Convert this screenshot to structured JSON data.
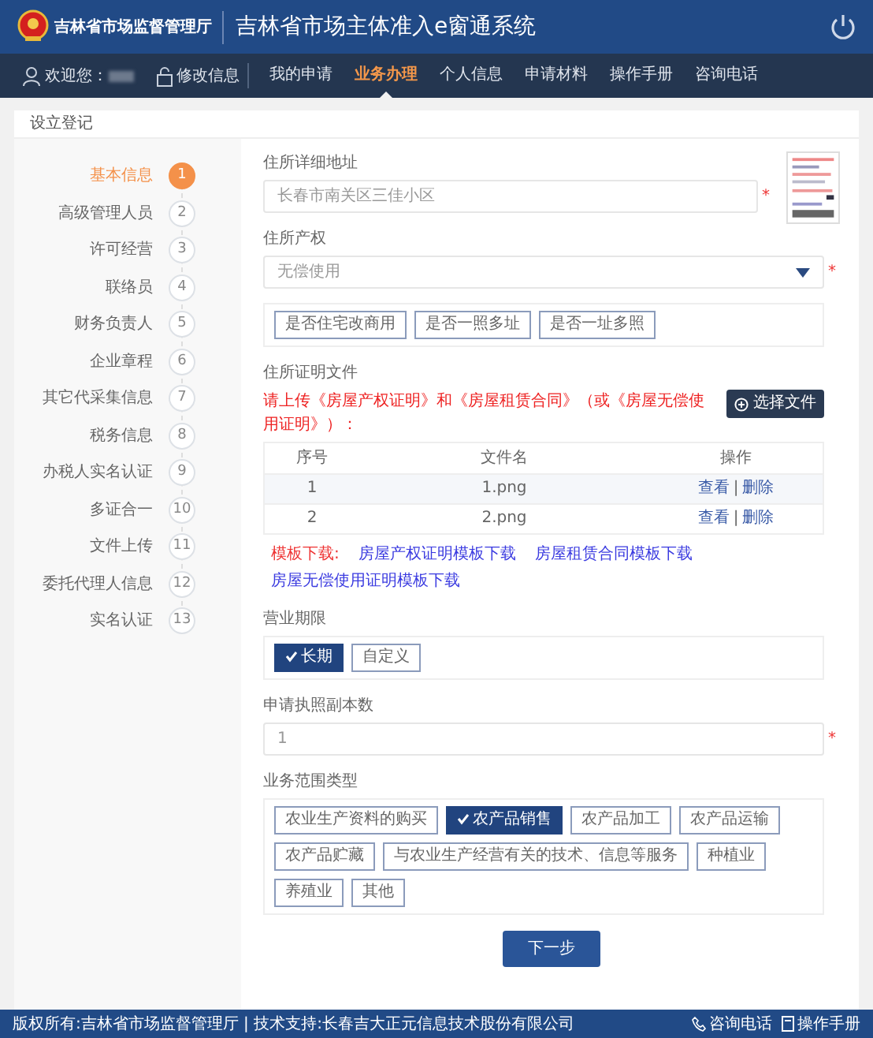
{
  "header": {
    "agency": "吉林省市场监督管理厅",
    "system_title": "吉林省市场主体准入e窗通系统"
  },
  "user_bar": {
    "welcome": "欢迎您：",
    "edit_info": "修改信息"
  },
  "nav": [
    {
      "label": "我的申请",
      "selected": false
    },
    {
      "label": "业务办理",
      "selected": true
    },
    {
      "label": "个人信息",
      "selected": false
    },
    {
      "label": "申请材料",
      "selected": false
    },
    {
      "label": "操作手册",
      "selected": false
    },
    {
      "label": "咨询电话",
      "selected": false
    }
  ],
  "card_title": "设立登记",
  "steps": [
    {
      "number": "1",
      "label": "基本信息",
      "selected": true
    },
    {
      "number": "2",
      "label": "高级管理人员",
      "selected": false
    },
    {
      "number": "3",
      "label": "许可经营",
      "selected": false
    },
    {
      "number": "4",
      "label": "联络员",
      "selected": false
    },
    {
      "number": "5",
      "label": "财务负责人",
      "selected": false
    },
    {
      "number": "6",
      "label": "企业章程",
      "selected": false
    },
    {
      "number": "7",
      "label": "其它代采集信息",
      "selected": false
    },
    {
      "number": "8",
      "label": "税务信息",
      "selected": false
    },
    {
      "number": "9",
      "label": "办税人实名认证",
      "selected": false
    },
    {
      "number": "10",
      "label": "多证合一",
      "selected": false
    },
    {
      "number": "11",
      "label": "文件上传",
      "selected": false
    },
    {
      "number": "12",
      "label": "委托代理人信息",
      "selected": false
    },
    {
      "number": "13",
      "label": "实名认证",
      "selected": false
    }
  ],
  "address": {
    "label": "住所详细地址",
    "value": "长春市南关区三佳小区",
    "required_mark": "*"
  },
  "property": {
    "label": "住所产权",
    "value": "无偿使用",
    "required_mark": "*"
  },
  "property_options": [
    {
      "label": "是否住宅改商用",
      "selected": false
    },
    {
      "label": "是否一照多址",
      "selected": false
    },
    {
      "label": "是否一址多照",
      "selected": false
    }
  ],
  "proof_files": {
    "label": "住所证明文件",
    "instruction": "请上传《房屋产权证明》和《房屋租赁合同》（或《房屋无偿使用证明》）：",
    "choose_button": "选择文件",
    "columns": [
      "序号",
      "文件名",
      "操作"
    ],
    "rows": [
      {
        "index": "1",
        "file": "1.png",
        "view": "查看",
        "separator": "|",
        "delete": "删除"
      },
      {
        "index": "2",
        "file": "2.png",
        "view": "查看",
        "separator": "|",
        "delete": "删除"
      }
    ],
    "template_label": "模板下载:",
    "template_links": [
      "房屋产权证明模板下载",
      "房屋租赁合同模板下载",
      "房屋无偿使用证明模板下载"
    ]
  },
  "term": {
    "label": "营业期限",
    "options": [
      {
        "label": "长期",
        "selected": true
      },
      {
        "label": "自定义",
        "selected": false
      }
    ]
  },
  "copies": {
    "label": "申请执照副本数",
    "value": "1",
    "required_mark": "*"
  },
  "scope": {
    "label": "业务范围类型",
    "options": [
      {
        "label": "农业生产资料的购买",
        "selected": false
      },
      {
        "label": "农产品销售",
        "selected": true
      },
      {
        "label": "农产品加工",
        "selected": false
      },
      {
        "label": "农产品运输",
        "selected": false
      },
      {
        "label": "农产品贮藏",
        "selected": false
      },
      {
        "label": "与农业生产经营有关的技术、信息等服务",
        "selected": false
      },
      {
        "label": "种植业",
        "selected": false
      },
      {
        "label": "养殖业",
        "selected": false
      },
      {
        "label": "其他",
        "selected": false
      }
    ]
  },
  "next_button": "下一步",
  "footer": {
    "copyright": "版权所有:吉林省市场监督管理厅 | 技术支持:长春吉大正元信息技术股份有限公司",
    "phone": "咨询电话",
    "manual": "操作手册"
  }
}
